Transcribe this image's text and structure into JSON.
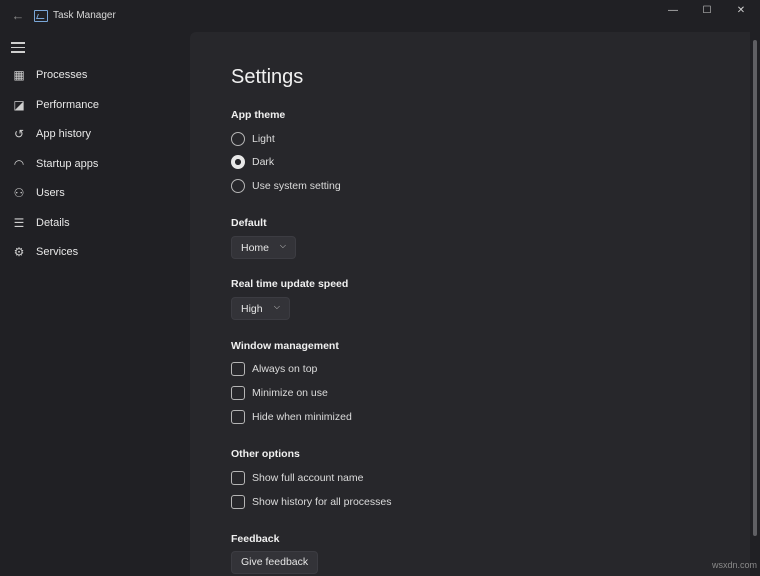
{
  "window": {
    "title": "Task Manager"
  },
  "sidebar": {
    "items": [
      {
        "label": "Processes",
        "icon": "processes-icon"
      },
      {
        "label": "Performance",
        "icon": "performance-icon"
      },
      {
        "label": "App history",
        "icon": "history-icon"
      },
      {
        "label": "Startup apps",
        "icon": "startup-icon"
      },
      {
        "label": "Users",
        "icon": "users-icon"
      },
      {
        "label": "Details",
        "icon": "details-icon"
      },
      {
        "label": "Services",
        "icon": "services-icon"
      }
    ]
  },
  "settings": {
    "title": "Settings",
    "app_theme": {
      "label": "App theme",
      "options": [
        "Light",
        "Dark",
        "Use system setting"
      ],
      "selected": "Dark"
    },
    "default": {
      "label": "Default",
      "value": "Home"
    },
    "update_speed": {
      "label": "Real time update speed",
      "value": "High"
    },
    "window_management": {
      "label": "Window management",
      "options": [
        "Always on top",
        "Minimize on use",
        "Hide when minimized"
      ]
    },
    "other_options": {
      "label": "Other options",
      "options": [
        "Show full account name",
        "Show history for all processes"
      ]
    },
    "feedback": {
      "label": "Feedback",
      "button": "Give feedback"
    }
  },
  "watermark": "wsxdn.com"
}
